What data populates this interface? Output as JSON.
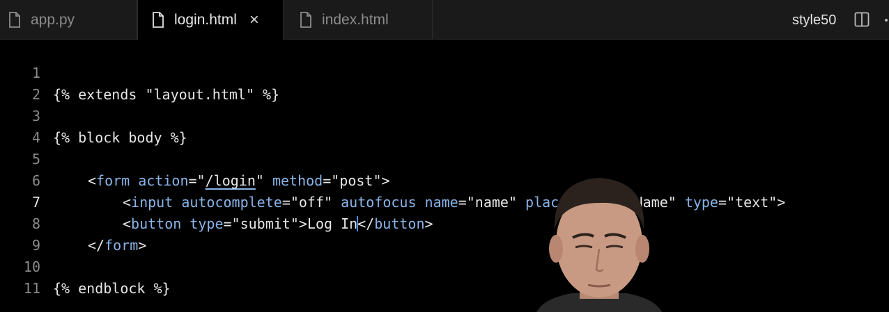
{
  "tabs": [
    {
      "label": "app.py",
      "active": false
    },
    {
      "label": "login.html",
      "active": true,
      "close_glyph": "×"
    },
    {
      "label": "index.html",
      "active": false
    }
  ],
  "toolbar": {
    "right_label": "style50",
    "split_icon": "split-editor-icon"
  },
  "editor": {
    "current_line": 7,
    "line_numbers": [
      "1",
      "2",
      "3",
      "4",
      "5",
      "6",
      "7",
      "8",
      "9",
      "10",
      "11"
    ],
    "lines": {
      "l1": "{% extends \"layout.html\" %}",
      "l3": "{% block body %}",
      "l5": {
        "open": "<",
        "tag": "form",
        "sp1": " ",
        "attr1": "action",
        "eq1": "=\"",
        "val1": "/login",
        "q1": "\" ",
        "attr2": "method",
        "eq2": "=\"post\">"
      },
      "l6": {
        "open": "<",
        "tag": "input",
        "sp": " ",
        "attr1": "autocomplete",
        "val1": "=\"off\" ",
        "attr2": "autofocus",
        "sp2": " ",
        "attr3": "name",
        "val3": "=\"name\" ",
        "attr4": "placeholder",
        "val4": "=\"Name\" ",
        "attr5": "type",
        "val5": "=\"text\">"
      },
      "l7": {
        "open": "<",
        "tag": "button",
        "sp": " ",
        "attr1": "type",
        "val1": "=\"submit\">Log In",
        "close_open": "</",
        "close_tag": "button",
        "close_end": ">"
      },
      "l8": {
        "open": "</",
        "tag": "form",
        "end": ">"
      },
      "l10": "{% endblock %}"
    }
  },
  "colors": {
    "background": "#000000",
    "tabbar": "#1a1a1a",
    "keyword": "#8ab4e8",
    "text": "#e6e6e6",
    "line_number": "#8a8a8a",
    "cursor": "#4f8cff"
  }
}
